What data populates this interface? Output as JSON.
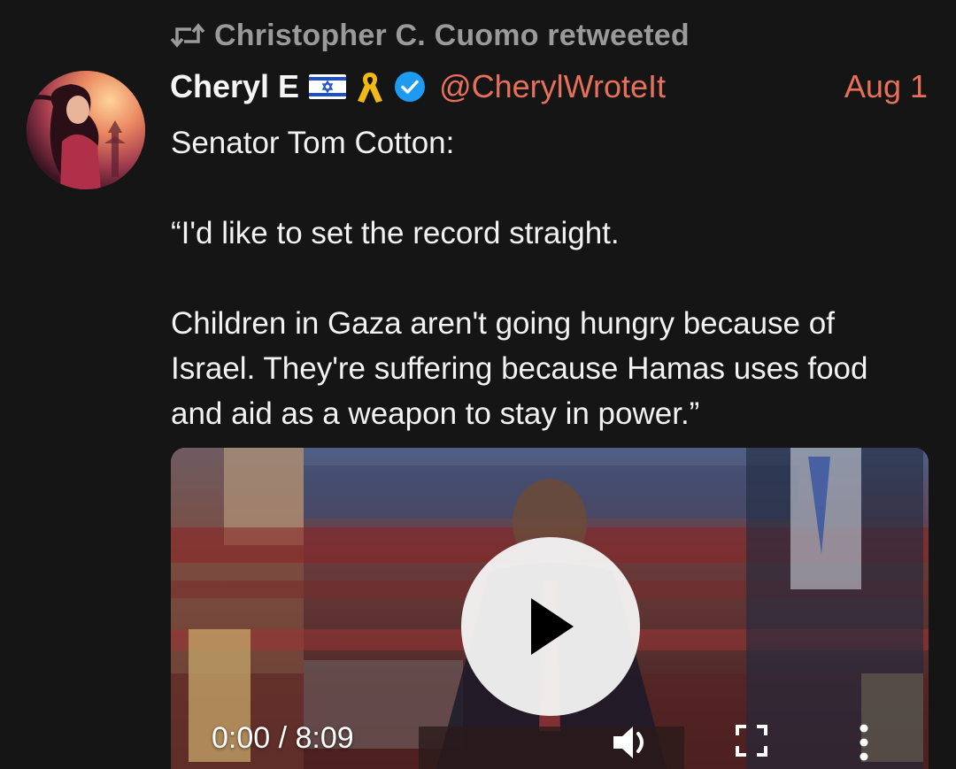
{
  "retweet": {
    "icon": "retweet-icon",
    "text": "Christopher C. Cuomo retweeted"
  },
  "author": {
    "name": "Cheryl E",
    "badges": [
      "israel-flag-icon",
      "yellow-ribbon-icon",
      "verified-badge-icon"
    ],
    "handle": "@CherylWroteIt",
    "avatar": "avatar"
  },
  "tweet": {
    "date": "Aug 1",
    "lines": [
      "Senator Tom Cotton:",
      "",
      "“I'd like to set the record straight.",
      "",
      "Children in Gaza aren't going hungry because of Israel. They're suffering because Hamas uses food and aid as a weapon to stay in power.”"
    ]
  },
  "video": {
    "time": "0:00 / 8:09",
    "controls": [
      "play-icon",
      "volume-icon",
      "fullscreen-icon",
      "more-options-icon"
    ]
  },
  "colors": {
    "background": "#151515",
    "accent": "#e8705a",
    "muted": "#9a9a9a",
    "verified": "#1d9bf0"
  }
}
